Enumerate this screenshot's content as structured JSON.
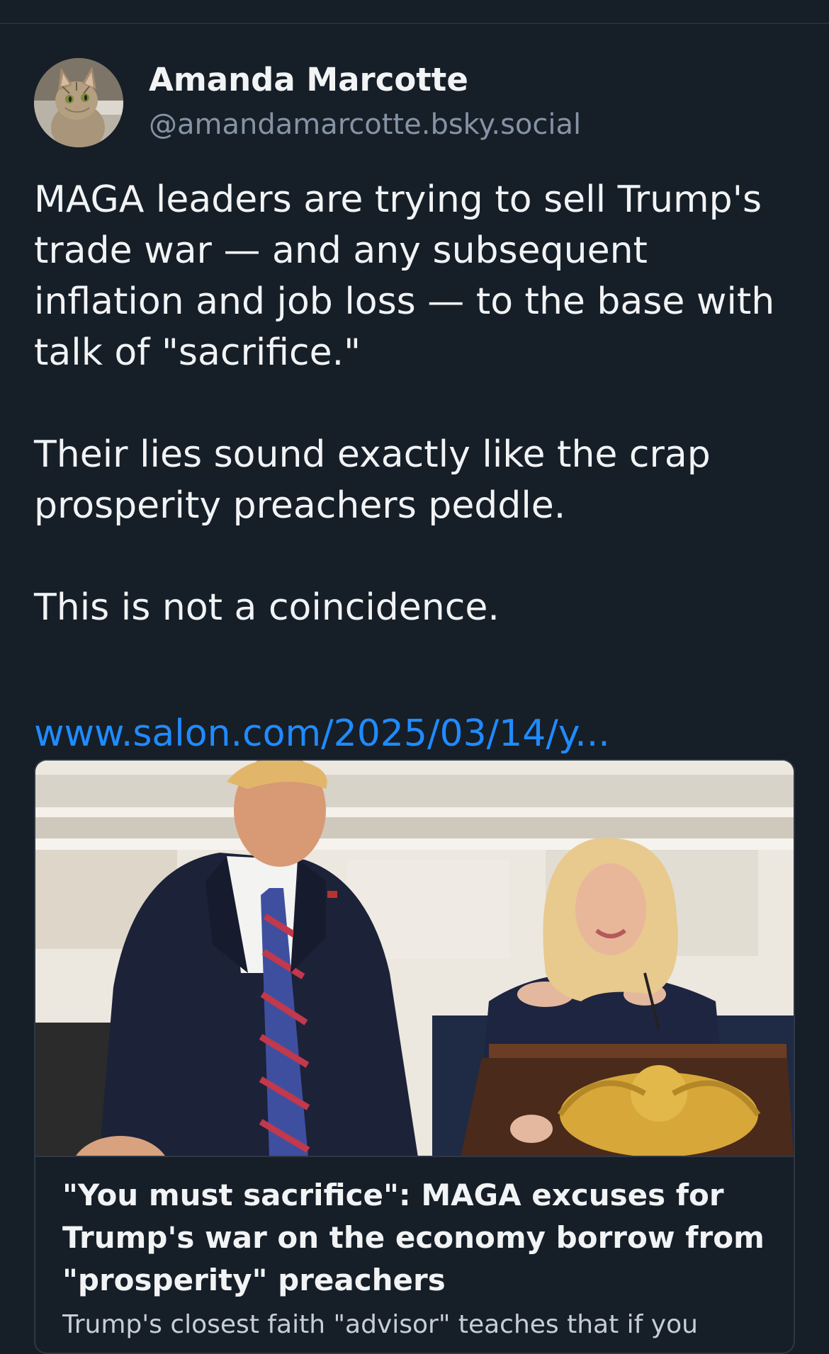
{
  "post": {
    "author": {
      "display_name": "Amanda Marcotte",
      "handle": "@amandamarcotte.bsky.social"
    },
    "paragraphs": [
      "MAGA leaders are trying to sell Trump's trade war — and any subsequent inflation and job loss — to the base with talk of \"sacrifice.\"",
      "Their lies sound exactly like the crap prosperity preachers peddle.",
      "This is not a coincidence."
    ],
    "link_text": "www.salon.com/2025/03/14/y..."
  },
  "link_card": {
    "title": "\"You must sacrifice\": MAGA excuses for Trump's war on the economy borrow from \"prosperity\" preachers",
    "description": "Trump's closest faith \"advisor\" teaches that if you"
  },
  "colors": {
    "background": "#161e27",
    "text": "#f1f3f5",
    "muted": "#8593a5",
    "link": "#208bfe",
    "border": "#2e3845"
  }
}
